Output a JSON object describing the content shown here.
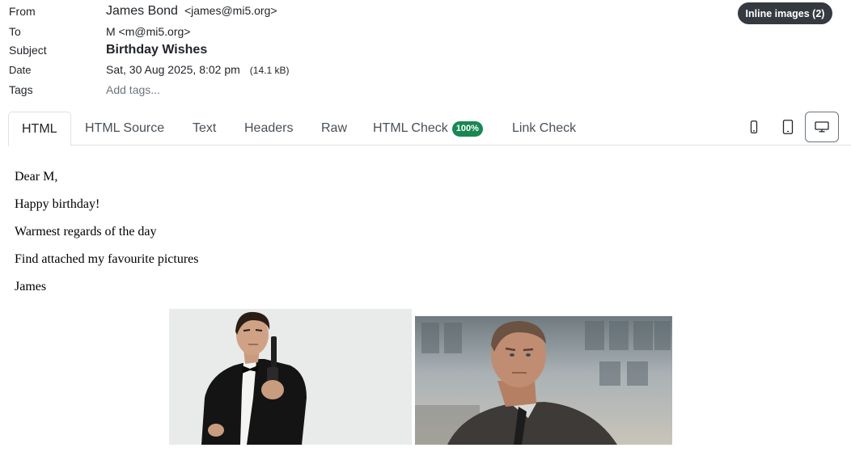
{
  "header": {
    "from_label": "From",
    "from_name": "James Bond",
    "from_email": "<james@mi5.org>",
    "to_label": "To",
    "to_value": "M <m@mi5.org>",
    "subject_label": "Subject",
    "subject_value": "Birthday Wishes",
    "date_label": "Date",
    "date_value": "Sat, 30 Aug 2025, 8:02 pm",
    "size_value": "(14.1 kB)",
    "tags_label": "Tags",
    "tags_placeholder": "Add tags...",
    "inline_images_label": "Inline images (2)"
  },
  "tabs": [
    {
      "label": "HTML",
      "active": true
    },
    {
      "label": "HTML Source"
    },
    {
      "label": "Text"
    },
    {
      "label": "Headers"
    },
    {
      "label": "Raw"
    },
    {
      "label": "HTML Check",
      "badge": "100%"
    },
    {
      "label": "Link Check"
    }
  ],
  "device_buttons": [
    {
      "icon": "mobile-icon"
    },
    {
      "icon": "tablet-icon"
    },
    {
      "icon": "desktop-icon",
      "active": true
    }
  ],
  "message": {
    "lines": [
      "Dear M,",
      "Happy birthday!",
      "Warmest regards of the day",
      "Find attached my favourite pictures",
      "James"
    ]
  },
  "colors": {
    "badge_dark": "#343a40",
    "score_green": "#198754",
    "muted": "#6c757d"
  }
}
